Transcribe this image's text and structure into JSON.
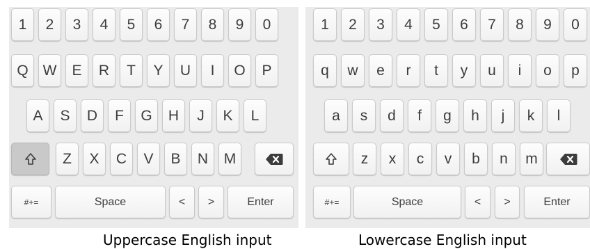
{
  "keyboards": [
    {
      "rows": [
        [
          "1",
          "2",
          "3",
          "4",
          "5",
          "6",
          "7",
          "8",
          "9",
          "0"
        ],
        [
          "Q",
          "W",
          "E",
          "R",
          "T",
          "Y",
          "U",
          "I",
          "O",
          "P"
        ],
        [
          "A",
          "S",
          "D",
          "F",
          "G",
          "H",
          "J",
          "K",
          "L"
        ],
        [
          "Z",
          "X",
          "C",
          "V",
          "B",
          "N",
          "M"
        ]
      ],
      "shift_active": true,
      "symbols_label": "#+=",
      "space_label": "Space",
      "left_label": "<",
      "right_label": ">",
      "enter_label": "Enter",
      "caption": "Uppercase English input"
    },
    {
      "rows": [
        [
          "1",
          "2",
          "3",
          "4",
          "5",
          "6",
          "7",
          "8",
          "9",
          "0"
        ],
        [
          "q",
          "w",
          "e",
          "r",
          "t",
          "y",
          "u",
          "i",
          "o",
          "p"
        ],
        [
          "a",
          "s",
          "d",
          "f",
          "g",
          "h",
          "j",
          "k",
          "l"
        ],
        [
          "z",
          "x",
          "c",
          "v",
          "b",
          "n",
          "m"
        ]
      ],
      "shift_active": false,
      "symbols_label": "#+=",
      "space_label": "Space",
      "left_label": "<",
      "right_label": ">",
      "enter_label": "Enter",
      "caption": "Lowercase English input"
    }
  ],
  "icons": {
    "shift": "shift-arrow-icon",
    "backspace": "backspace-icon"
  },
  "colors": {
    "panel": "#ebebeb",
    "key": "#f7f7f7",
    "shift_active": "#c9c9c9",
    "text": "#3c3c3c"
  }
}
